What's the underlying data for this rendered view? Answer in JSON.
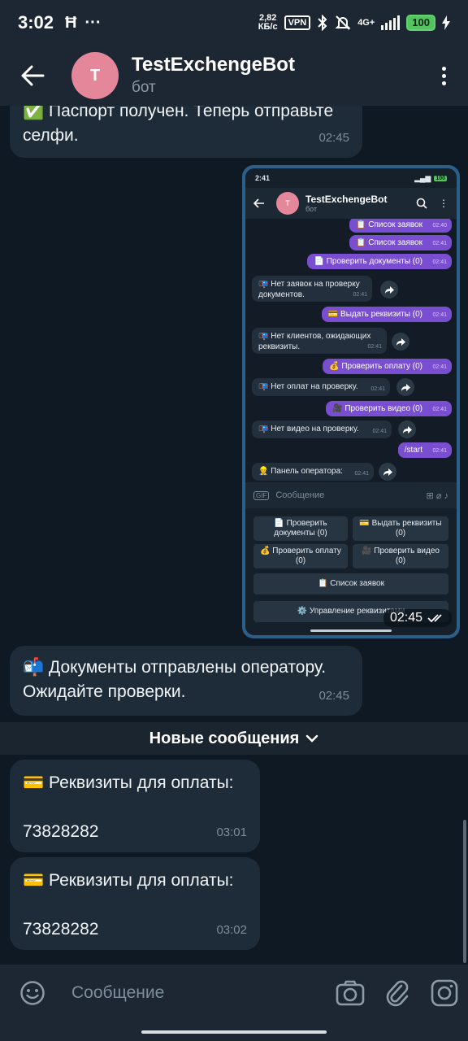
{
  "status_bar": {
    "time": "3:02",
    "left_icons": [
      "hotspot-h-icon",
      "more-dots-icon"
    ],
    "net_speed_value": "2,82",
    "net_speed_unit": "КБ/с",
    "vpn": "VPN",
    "network": "4G+",
    "battery": "100"
  },
  "header": {
    "avatar_letter": "T",
    "title": "TestExchengeBot",
    "subtitle": "бот"
  },
  "messages": {
    "passport": {
      "text_line1": "✅ Паспорт получен. Теперь отправьте",
      "text_line2": "селфи.",
      "time": "02:45"
    },
    "screenshot_time": "02:45",
    "docs_sent": {
      "text_line1": "📬 Документы отправлены оператору.",
      "text_line2": "Ожидайте проверки.",
      "time": "02:45"
    },
    "new_messages_label": "Новые сообщения",
    "req1": {
      "title": "💳 Реквизиты для оплаты:",
      "number": "73828282",
      "time": "03:01"
    },
    "req2": {
      "title": "💳 Реквизиты для оплаты:",
      "number": "73828282",
      "time": "03:02"
    }
  },
  "screenshot": {
    "status_time": "2:41",
    "battery": "100",
    "avatar_letter": "T",
    "title": "TestExchengeBot",
    "subtitle": "бот",
    "msgs": [
      {
        "kind": "out",
        "text": "📋 Список заявок",
        "time": "02:40"
      },
      {
        "kind": "out",
        "text": "📋 Список заявок",
        "time": "02:41"
      },
      {
        "kind": "out",
        "text": "📄 Проверить документы (0)",
        "time": "02:41"
      },
      {
        "kind": "in",
        "line1": "📭 Нет заявок на проверку",
        "line2": "документов.",
        "time": "02:41"
      },
      {
        "kind": "out",
        "text": "💳 Выдать реквизиты (0)",
        "time": "02:41"
      },
      {
        "kind": "in",
        "line1": "📭 Нет клиентов, ожидающих",
        "line2": "реквизиты.",
        "time": "02:41"
      },
      {
        "kind": "out",
        "text": "💰 Проверить оплату (0)",
        "time": "02:41"
      },
      {
        "kind": "in",
        "line1": "📭 Нет оплат на проверку.",
        "time": "02:41"
      },
      {
        "kind": "out",
        "text": "🎥 Проверить видео (0)",
        "time": "02:41"
      },
      {
        "kind": "in",
        "line1": "📭 Нет видео на проверку.",
        "time": "02:41"
      },
      {
        "kind": "out",
        "text": "/start",
        "time": "02:41"
      },
      {
        "kind": "in",
        "line1": "👷 Панель оператора:",
        "time": "02:41"
      }
    ],
    "input_placeholder": "Сообщение",
    "gif_label": "GIF",
    "keys": {
      "check_docs_l1": "📄 Проверить",
      "check_docs_l2": "документы (0)",
      "give_req_l1": "💳 Выдать реквизиты",
      "give_req_l2": "(0)",
      "check_pay_l1": "💰 Проверить оплату",
      "check_pay_l2": "(0)",
      "check_video_l1": "🎥 Проверить видео",
      "check_video_l2": "(0)",
      "list": "📋 Список заявок",
      "manage": "⚙️ Управление реквизитами"
    }
  },
  "input": {
    "placeholder": "Сообщение"
  }
}
